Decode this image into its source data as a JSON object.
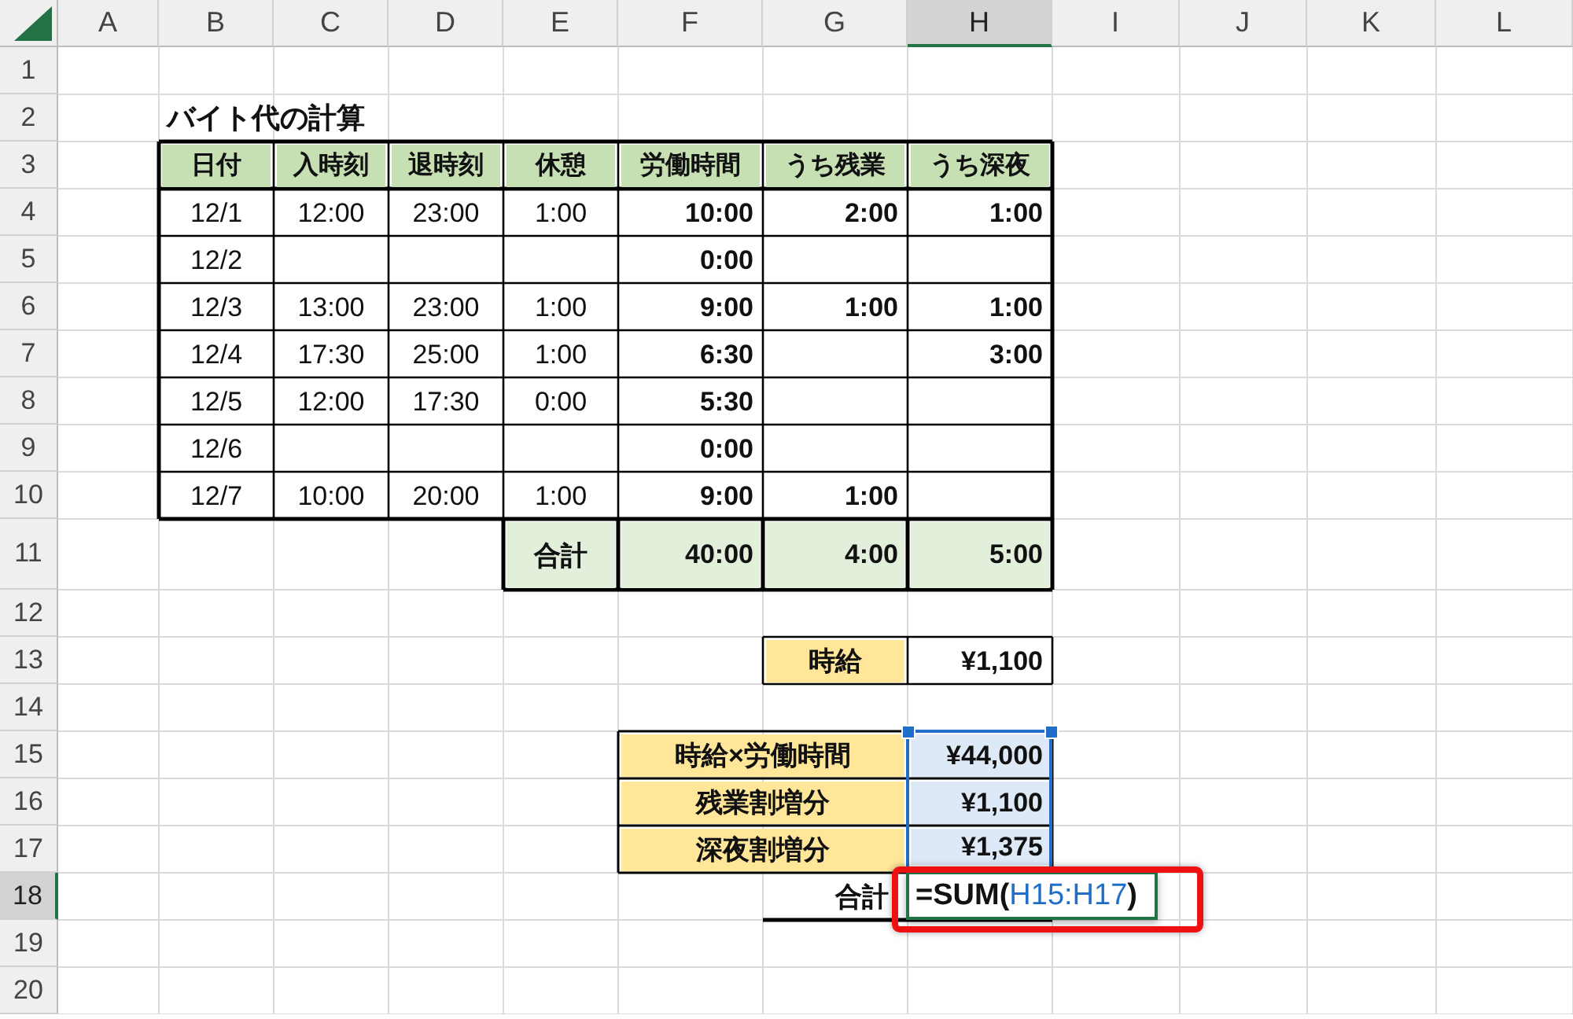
{
  "columns": [
    {
      "label": "A",
      "selected": false
    },
    {
      "label": "B",
      "selected": false
    },
    {
      "label": "C",
      "selected": false
    },
    {
      "label": "D",
      "selected": false
    },
    {
      "label": "E",
      "selected": false
    },
    {
      "label": "F",
      "selected": false
    },
    {
      "label": "G",
      "selected": false
    },
    {
      "label": "H",
      "selected": true
    },
    {
      "label": "I",
      "selected": false
    },
    {
      "label": "J",
      "selected": false
    },
    {
      "label": "K",
      "selected": false
    },
    {
      "label": "L",
      "selected": false
    }
  ],
  "row_numbers": [
    {
      "label": "1",
      "selected": false
    },
    {
      "label": "2",
      "selected": false
    },
    {
      "label": "3",
      "selected": false
    },
    {
      "label": "4",
      "selected": false
    },
    {
      "label": "5",
      "selected": false
    },
    {
      "label": "6",
      "selected": false
    },
    {
      "label": "7",
      "selected": false
    },
    {
      "label": "8",
      "selected": false
    },
    {
      "label": "9",
      "selected": false
    },
    {
      "label": "10",
      "selected": false
    },
    {
      "label": "11",
      "selected": false
    },
    {
      "label": "12",
      "selected": false
    },
    {
      "label": "13",
      "selected": false
    },
    {
      "label": "14",
      "selected": false
    },
    {
      "label": "15",
      "selected": false
    },
    {
      "label": "16",
      "selected": false
    },
    {
      "label": "17",
      "selected": false
    },
    {
      "label": "18",
      "selected": true
    },
    {
      "label": "19",
      "selected": false
    },
    {
      "label": "20",
      "selected": false
    }
  ],
  "title": "バイト代の計算",
  "time_table": {
    "headers": [
      "日付",
      "入時刻",
      "退時刻",
      "休憩",
      "労働時間",
      "うち残業",
      "うち深夜"
    ],
    "rows": [
      {
        "date": "12/1",
        "start": "12:00",
        "end": "23:00",
        "break": "1:00",
        "hours": "10:00",
        "overtime": "2:00",
        "night": "1:00"
      },
      {
        "date": "12/2",
        "hours": "0:00"
      },
      {
        "date": "12/3",
        "start": "13:00",
        "end": "23:00",
        "break": "1:00",
        "hours": "9:00",
        "overtime": "1:00",
        "night": "1:00"
      },
      {
        "date": "12/4",
        "start": "17:30",
        "end": "25:00",
        "break": "1:00",
        "hours": "6:30",
        "night": "3:00"
      },
      {
        "date": "12/5",
        "start": "12:00",
        "end": "17:30",
        "break": "0:00",
        "hours": "5:30"
      },
      {
        "date": "12/6",
        "hours": "0:00"
      },
      {
        "date": "12/7",
        "start": "10:00",
        "end": "20:00",
        "break": "1:00",
        "hours": "9:00",
        "overtime": "1:00"
      }
    ],
    "totals": {
      "label": "合計",
      "hours": "40:00",
      "overtime": "4:00",
      "night": "5:00"
    }
  },
  "hourly_wage": {
    "label": "時給",
    "value": "¥1,100"
  },
  "pay_items": [
    {
      "label": "時給×労働時間",
      "value": "¥44,000",
      "selected": true
    },
    {
      "label": "残業割増分",
      "value": "¥1,100",
      "selected": true
    },
    {
      "label": "深夜割増分",
      "value": "¥1,375",
      "selected": true
    }
  ],
  "sum": {
    "label": "合計",
    "formula": [
      {
        "text": "=SUM(",
        "reference": false
      },
      {
        "text": "H15:H17",
        "reference": true
      },
      {
        "text": ")",
        "reference": false
      }
    ]
  }
}
